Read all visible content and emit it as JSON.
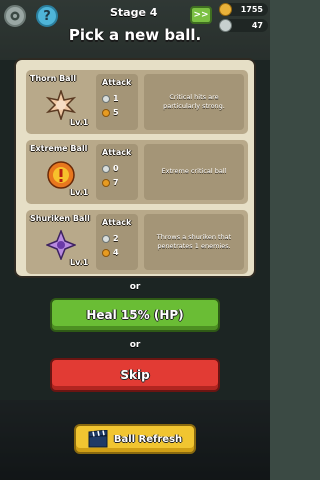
{
  "header": {
    "stage_label": "Stage 4",
    "fast_forward_label": ">>",
    "currency_gold": "1755",
    "currency_silver": "47",
    "settings_icon": "gear-icon",
    "help_label": "?"
  },
  "dialog": {
    "title": "Pick a new ball.",
    "attack_label": "Attack",
    "balls": [
      {
        "name": "Thorn Ball",
        "level": "Lv.1",
        "attack_silver": "1",
        "attack_gold": "5",
        "description": "Critical hits are particularly strong.",
        "icon": "thorn-ball-icon"
      },
      {
        "name": "Extreme Ball",
        "level": "Lv.1",
        "attack_silver": "0",
        "attack_gold": "7",
        "description": "Extreme critical ball",
        "icon": "extreme-ball-icon"
      },
      {
        "name": "Shuriken Ball",
        "level": "Lv.1",
        "attack_silver": "2",
        "attack_gold": "4",
        "description": "Throws a shuriken that penetrates 1 enemies.",
        "icon": "shuriken-ball-icon"
      }
    ],
    "or_label": "or",
    "heal_label": "Heal 15% (HP)",
    "skip_label": "Skip",
    "refresh_label": "Ball Refresh"
  },
  "colors": {
    "heal": "#6abd35",
    "skip": "#e23b34",
    "refresh": "#f1c531",
    "panel": "#e6dfc6"
  }
}
